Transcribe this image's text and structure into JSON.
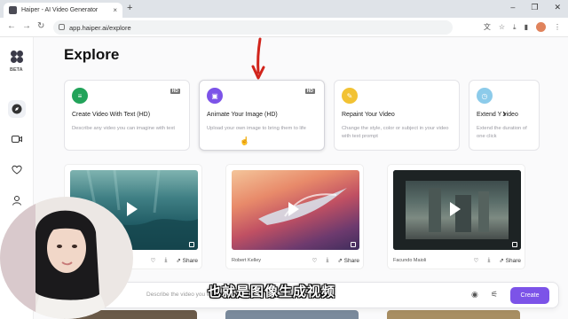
{
  "browser": {
    "tab_title": "Haiper - AI Video Generator",
    "tab_close": "×",
    "new_tab": "+",
    "url": "app.haiper.ai/explore",
    "window_controls": [
      "–",
      "❐",
      "✕"
    ]
  },
  "sidebar": {
    "beta_label": "BETA",
    "items": [
      {
        "icon": "compass-icon"
      },
      {
        "icon": "video-camera-icon"
      },
      {
        "icon": "heart-icon"
      },
      {
        "icon": "user-icon"
      }
    ]
  },
  "explore": {
    "title": "Explore",
    "tools": [
      {
        "title": "Create Video With Text (HD)",
        "desc": "Describe any video you can imagine with text",
        "badge": "HD",
        "color": "#22a35a"
      },
      {
        "title": "Animate Your Image (HD)",
        "desc": "Upload your own image to bring them to life",
        "badge": "HD",
        "color": "#7c53e8"
      },
      {
        "title": "Repaint Your Video",
        "desc": "Change the style, color or subject in your video with text prompt",
        "badge": "",
        "color": "#f2c233"
      },
      {
        "title": "Extend Y   video",
        "desc": "Extend the duration of one click",
        "badge": "",
        "color": "#8ccbea"
      }
    ],
    "next_label": "›"
  },
  "videos": [
    {
      "author": "",
      "share": "Share"
    },
    {
      "author": "Robert Kelley",
      "share": "Share"
    },
    {
      "author": "Facundo Maioli",
      "share": "Share"
    }
  ],
  "prompt": {
    "placeholder": "Describe the video you want to gen",
    "create_label": "Create"
  },
  "overlay": {
    "subtitle": "也就是图像生成视频"
  },
  "colors": {
    "accent": "#7c53e8",
    "annotation_arrow": "#d1241b"
  }
}
